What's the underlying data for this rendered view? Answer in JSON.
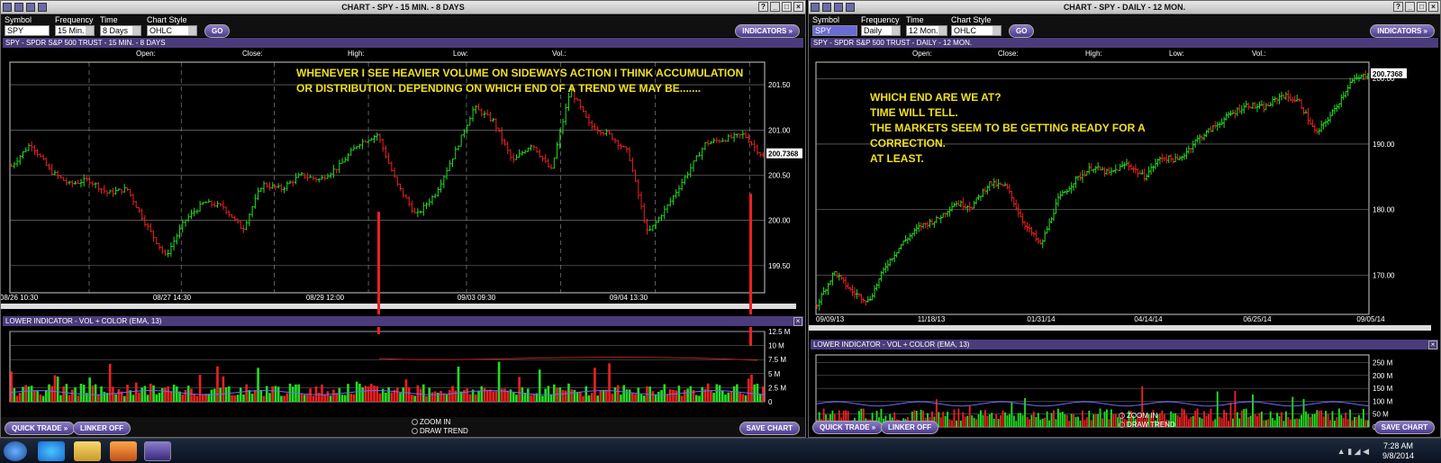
{
  "left": {
    "title": "CHART - SPY - 15 MIN. - 8 DAYS",
    "toolbar": {
      "symbol_label": "Symbol",
      "symbol_value": "SPY",
      "frequency_label": "Frequency",
      "frequency_value": "15 Min.",
      "period_label": "Time Period",
      "period_value": "8 Days",
      "style_label": "Chart Style",
      "style_value": "OHLC",
      "go_label": "GO",
      "indicators_label": "INDICATORS »"
    },
    "panel_title": "SPY - SPDR S&P 500 TRUST - 15 MIN. - 8 DAYS",
    "ohlc": {
      "open": "Open:",
      "close": "Close:",
      "high": "High:",
      "low": "Low:",
      "vol": "Vol.:"
    },
    "annotation": "WHENEVER I SEE HEAVIER VOLUME ON SIDEWAYS ACTION I THINK ACCUMULATION\nOR DISTRIBUTION. DEPENDING ON WHICH END OF A TREND WE MAY BE.......",
    "lower_title": "LOWER INDICATOR - VOL + COLOR (EMA, 13)",
    "quick_trade": "QUICK TRADE »",
    "linker": "LINKER OFF",
    "zoom_in": "ZOOM IN",
    "draw_trend": "DRAW TREND",
    "save_chart": "SAVE CHART"
  },
  "right": {
    "title": "CHART - SPY - DAILY - 12 MON.",
    "toolbar": {
      "symbol_label": "Symbol",
      "symbol_value": "SPY",
      "frequency_label": "Frequency",
      "frequency_value": "Daily",
      "period_label": "Time Period",
      "period_value": "12 Mon.",
      "style_label": "Chart Style",
      "style_value": "OHLC",
      "go_label": "GO",
      "indicators_label": "INDICATORS »"
    },
    "panel_title": "SPY - SPDR S&P 500 TRUST - DAILY - 12 MON.",
    "ohlc": {
      "open": "Open:",
      "close": "Close:",
      "high": "High:",
      "low": "Low:",
      "vol": "Vol.:"
    },
    "annotation": "WHICH END ARE WE AT?\nTIME WILL TELL.\nTHE MARKETS SEEM TO BE GETTING READY FOR A\nCORRECTION.\nAT LEAST.",
    "lower_title": "LOWER INDICATOR - VOL + COLOR (EMA, 13)",
    "quick_trade": "QUICK TRADE »",
    "linker": "LINKER OFF",
    "zoom_in": "ZOOM IN",
    "draw_trend": "DRAW TREND",
    "save_chart": "SAVE CHART"
  },
  "taskbar": {
    "time": "7:28 AM",
    "date": "9/8/2014"
  },
  "colors": {
    "up": "#22dd22",
    "down": "#ee2020",
    "ema": "#6a6aff",
    "accent": "#4a3c7a",
    "annotation": "#f0e020"
  },
  "chart_data": [
    {
      "type": "ohlc",
      "title": "SPY - SPDR S&P 500 TRUST - 15 MIN. - 8 DAYS",
      "x_ticks": [
        "08/26 10:30",
        "08/27 14:30",
        "08/29 12:00",
        "09/03 09:30",
        "09/04 13:30"
      ],
      "y_ticks": [
        199.5,
        200.0,
        200.5,
        201.0,
        201.5
      ],
      "ylim": [
        199.2,
        201.75
      ],
      "last_price": "200.7368",
      "close_path": [
        200.6,
        200.85,
        200.55,
        200.4,
        200.45,
        200.3,
        200.35,
        199.95,
        199.6,
        200.0,
        200.2,
        200.15,
        199.9,
        200.4,
        200.35,
        200.5,
        200.45,
        200.6,
        200.85,
        200.95,
        200.4,
        200.05,
        200.3,
        200.75,
        201.25,
        201.1,
        200.65,
        200.85,
        200.55,
        201.45,
        201.05,
        200.95,
        200.75,
        199.85,
        200.15,
        200.5,
        200.85,
        200.9,
        200.95,
        200.7
      ],
      "volume_ticks": [
        "12.5 M",
        "10 M",
        "7.5 M",
        "5 M",
        "2.5 M",
        "0"
      ],
      "volume_ylim": [
        0,
        12.5
      ],
      "volume_markers": [
        12.0,
        10.0
      ]
    },
    {
      "type": "ohlc",
      "title": "SPY - SPDR S&P 500 TRUST - DAILY - 12 MON.",
      "x_ticks": [
        "09/09/13",
        "11/18/13",
        "01/31/14",
        "04/14/14",
        "06/25/14",
        "09/05/14"
      ],
      "y_ticks": [
        170.0,
        180.0,
        190.0,
        200.0
      ],
      "ylim": [
        164.0,
        202.5
      ],
      "last_price": "200.7368",
      "close_path": [
        165.5,
        170.5,
        167.5,
        166.0,
        171.5,
        175.0,
        177.5,
        178.5,
        181.0,
        180.5,
        184.0,
        183.5,
        178.0,
        174.5,
        181.5,
        184.5,
        186.5,
        185.5,
        187.0,
        185.0,
        188.0,
        187.5,
        190.5,
        192.5,
        194.5,
        196.0,
        195.5,
        197.5,
        196.5,
        191.5,
        195.0,
        199.5,
        200.7
      ],
      "volume_ticks": [
        "250 M",
        "200 M",
        "150 M",
        "100 M",
        "50 M",
        "0"
      ],
      "volume_ylim": [
        0,
        280
      ]
    }
  ]
}
